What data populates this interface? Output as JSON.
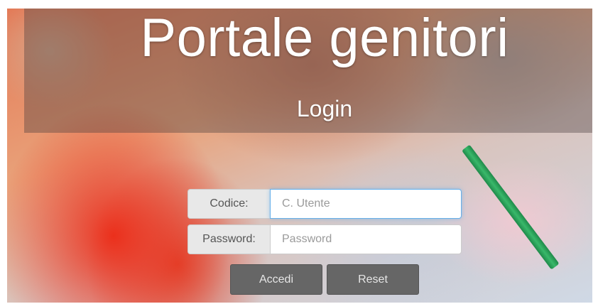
{
  "header": {
    "title": "Portale genitori",
    "subtitle": "Login"
  },
  "form": {
    "codice_label": "Codice:",
    "codice_placeholder": "C. Utente",
    "password_label": "Password:",
    "password_placeholder": "Password",
    "submit_label": "Accedi",
    "reset_label": "Reset"
  },
  "colors": {
    "button": "#666666",
    "addon": "#e8e8e8",
    "focus": "#66afe9"
  }
}
